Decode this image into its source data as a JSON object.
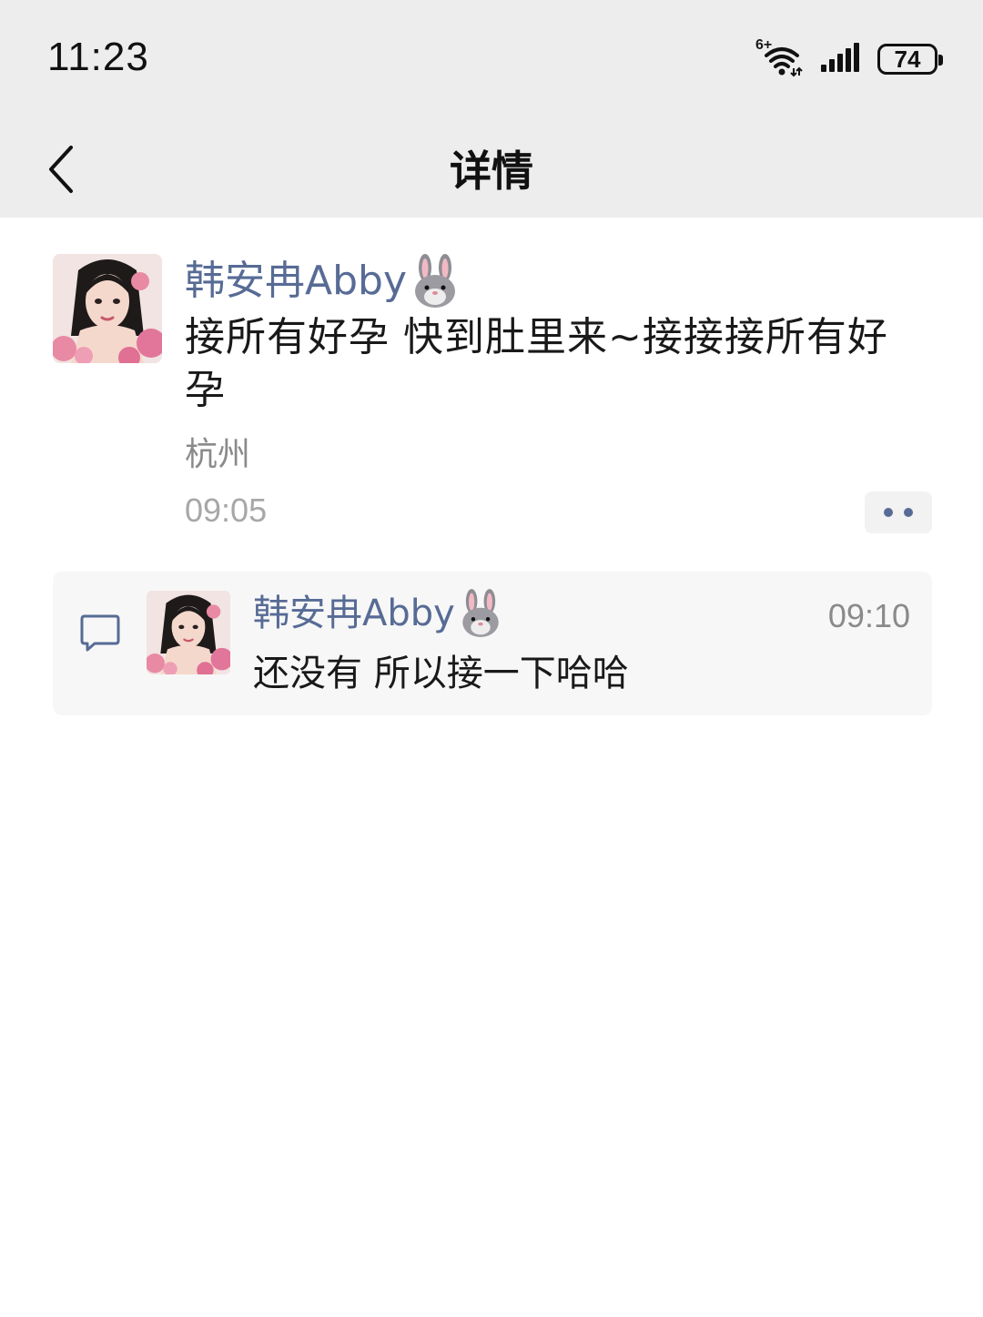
{
  "status_bar": {
    "time": "11:23",
    "network_label": "6+",
    "battery": "74",
    "icons": [
      "wifi-icon",
      "signal-icon",
      "battery-icon"
    ]
  },
  "nav": {
    "title": "详情",
    "back_icon": "chevron-left-icon"
  },
  "post": {
    "author": "韩安冉Abby",
    "author_emoji": "rabbit-emoji",
    "content": "接所有好孕 快到肚里来~接接接所有好孕",
    "location": "杭州",
    "time": "09:05",
    "more_icon": "more-dots-icon"
  },
  "comments": [
    {
      "author": "韩安冉Abby",
      "author_emoji": "rabbit-emoji",
      "time": "09:10",
      "text": "还没有 所以接一下哈哈"
    }
  ],
  "colors": {
    "header_bg": "#ededed",
    "link": "#576b95",
    "comment_bg": "#f7f7f7",
    "secondary_text": "#8a8a8a"
  }
}
